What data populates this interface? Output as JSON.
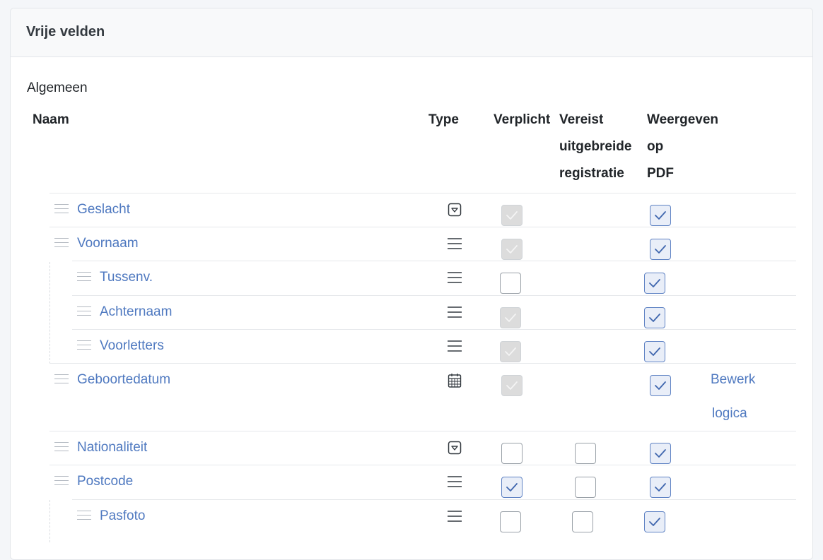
{
  "card": {
    "title": "Vrije velden"
  },
  "section": {
    "title": "Algemeen"
  },
  "columns": {
    "naam": "Naam",
    "type": "Type",
    "verplicht": "Verplicht",
    "vereist_l1": "Vereist",
    "vereist_l2": "uitgebreide",
    "vereist_l3": "registratie",
    "weergeven_l1": "Weergeven",
    "weergeven_l2": "op",
    "weergeven_l3": "PDF"
  },
  "rows": [
    {
      "name": "Geslacht",
      "type_icon": "dropdown-icon",
      "verplicht": "checked-disabled",
      "vereist": "none",
      "pdf": "checked"
    },
    {
      "name": "Voornaam",
      "type_icon": "text-lines-icon",
      "verplicht": "checked-disabled",
      "vereist": "none",
      "pdf": "checked"
    },
    {
      "name": "Tussenv.",
      "type_icon": "text-lines-icon",
      "verplicht": "unchecked",
      "vereist": "none",
      "pdf": "checked"
    },
    {
      "name": "Achternaam",
      "type_icon": "text-lines-icon",
      "verplicht": "checked-disabled",
      "vereist": "none",
      "pdf": "checked"
    },
    {
      "name": "Voorletters",
      "type_icon": "text-lines-icon",
      "verplicht": "checked-disabled",
      "vereist": "none",
      "pdf": "checked"
    },
    {
      "name": "Geboortedatum",
      "type_icon": "calendar-icon",
      "verplicht": "checked-disabled",
      "vereist": "none",
      "pdf": "checked",
      "action_l1": "Bewerk",
      "action_l2": "logica"
    },
    {
      "name": "Nationaliteit",
      "type_icon": "dropdown-icon",
      "verplicht": "unchecked",
      "vereist": "unchecked",
      "pdf": "checked"
    },
    {
      "name": "Postcode",
      "type_icon": "text-lines-icon",
      "verplicht": "checked",
      "vereist": "unchecked",
      "pdf": "checked"
    },
    {
      "name": "Pasfoto",
      "type_icon": "text-lines-icon",
      "verplicht": "unchecked",
      "vereist": "unchecked",
      "pdf": "checked"
    }
  ],
  "colors": {
    "link": "#4f79c0",
    "checked_border": "#5f83c4",
    "disabled_fill": "#dcdcdc"
  }
}
